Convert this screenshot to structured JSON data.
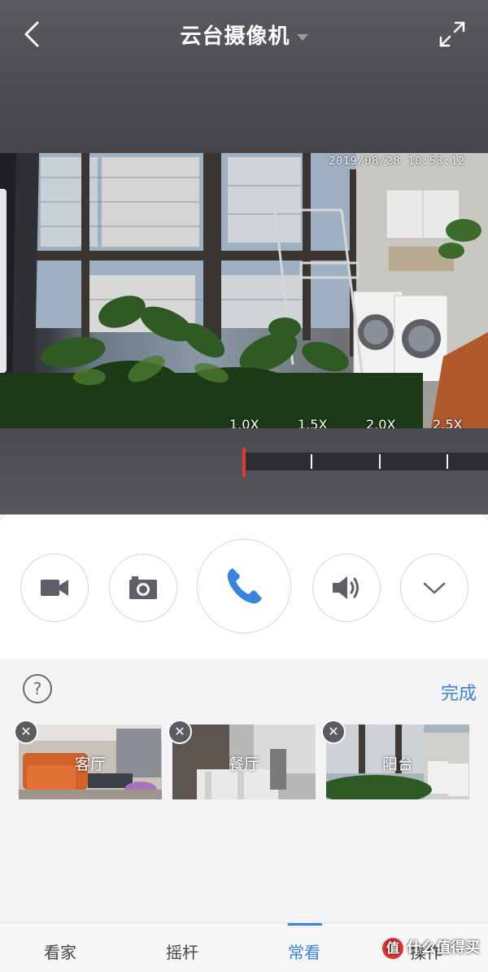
{
  "header": {
    "title": "云台摄像机",
    "back_icon": "chevron-left-icon",
    "expand_icon": "expand-icon"
  },
  "video": {
    "timestamp": "2019/08/28 10:53:12",
    "zoom_levels": [
      "1.0X",
      "1.5X",
      "2.0X",
      "2.5X"
    ]
  },
  "controls": [
    {
      "name": "record-button",
      "icon": "video-camera-icon"
    },
    {
      "name": "snapshot-button",
      "icon": "camera-icon"
    },
    {
      "name": "call-button",
      "icon": "phone-icon"
    },
    {
      "name": "volume-button",
      "icon": "speaker-icon"
    },
    {
      "name": "more-button",
      "icon": "chevron-down-icon"
    }
  ],
  "favorites": {
    "help_label": "?",
    "done_label": "完成",
    "items": [
      {
        "label": "客厅"
      },
      {
        "label": "餐厅"
      },
      {
        "label": "阳台"
      }
    ]
  },
  "tabs": [
    {
      "label": "看家",
      "active": false
    },
    {
      "label": "摇杆",
      "active": false
    },
    {
      "label": "常看",
      "active": true
    },
    {
      "label": "操作",
      "active": false
    }
  ],
  "watermark": {
    "text": "什么值得买",
    "badge": "值"
  },
  "colors": {
    "accent": "#3a82e0",
    "ruler_marker": "#e3372f",
    "header_bg": "#4b4c52"
  }
}
